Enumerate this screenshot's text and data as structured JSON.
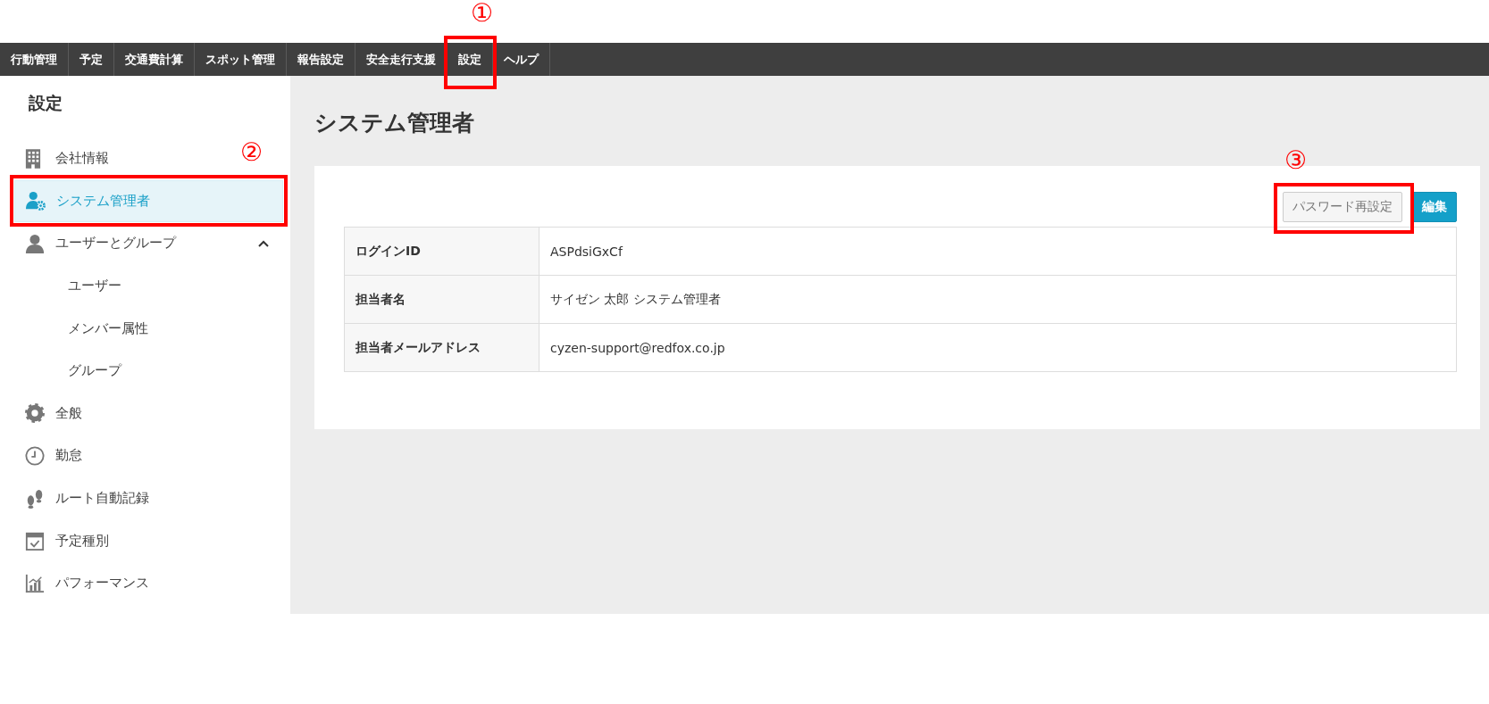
{
  "nav": {
    "items": [
      {
        "label": "行動管理"
      },
      {
        "label": "予定"
      },
      {
        "label": "交通費計算"
      },
      {
        "label": "スポット管理"
      },
      {
        "label": "報告設定"
      },
      {
        "label": "安全走行支援"
      },
      {
        "label": "設定"
      },
      {
        "label": "ヘルプ"
      }
    ]
  },
  "sidebar": {
    "title": "設定",
    "items": [
      {
        "label": "会社情報",
        "selected": false
      },
      {
        "label": "システム管理者",
        "selected": true
      },
      {
        "label": "ユーザーとグループ",
        "selected": false,
        "expanded": true,
        "children": [
          {
            "label": "ユーザー",
            "selected": false
          },
          {
            "label": "メンバー属性",
            "selected": false
          },
          {
            "label": "グループ",
            "selected": false
          }
        ]
      },
      {
        "label": "全般",
        "selected": false
      },
      {
        "label": "勤怠",
        "selected": false
      },
      {
        "label": "ルート自動記録",
        "selected": false
      },
      {
        "label": "予定種別",
        "selected": false
      },
      {
        "label": "パフォーマンス",
        "selected": false
      }
    ]
  },
  "main": {
    "title": "システム管理者",
    "buttons": [
      {
        "label": "パスワード再設定",
        "kind": "default"
      },
      {
        "label": "編集",
        "kind": "primary"
      }
    ],
    "table": {
      "rows": [
        {
          "label": "ログインID",
          "value": "ASPdsiGxCf"
        },
        {
          "label": "担当者名",
          "value": "サイゼン 太郎 システム管理者"
        },
        {
          "label": "担当者メールアドレス",
          "value": "cyzen-support@redfox.co.jp"
        }
      ]
    }
  },
  "annotations": [
    {
      "label": "①"
    },
    {
      "label": "②"
    },
    {
      "label": "③"
    }
  ]
}
